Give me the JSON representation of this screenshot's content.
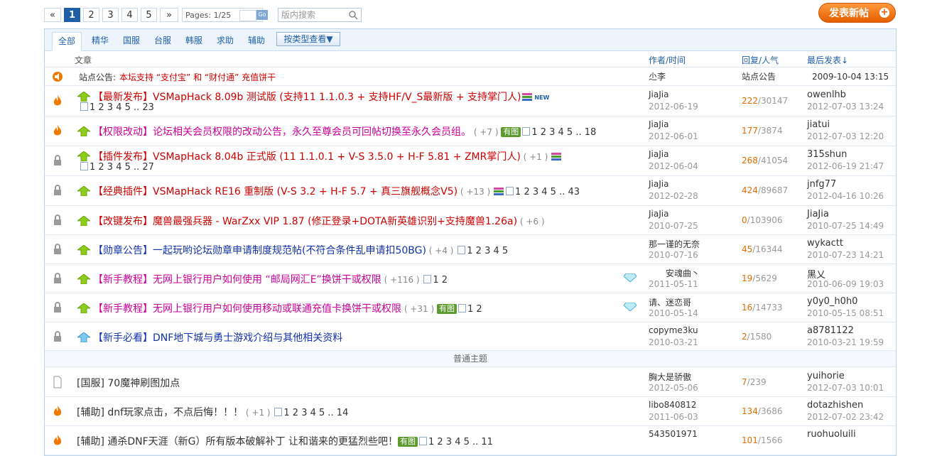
{
  "pagination": {
    "prev": "«",
    "pages": [
      "1",
      "2",
      "3",
      "4",
      "5"
    ],
    "next": "»",
    "label": "Pages: 1/25",
    "go": "Go",
    "search_placeholder": "版内搜索"
  },
  "post_button": "发表新帖",
  "tabs": [
    "全部",
    "精华",
    "国服",
    "台服",
    "韩服",
    "求助",
    "辅助"
  ],
  "type_button": "按类型查看▼",
  "header": {
    "article": "文章",
    "author": "作者/时间",
    "stats": "回复/人气",
    "last": "最后发表↓"
  },
  "announce": {
    "label": "站点公告:",
    "text": "本坛支持 “支付宝” 和 “财付通” 充值饼干",
    "author": "尐李",
    "stats": "站点公告",
    "date": "2009-10-04 13:15"
  },
  "threads": [
    {
      "cat": "【最新发布】",
      "title": "VSMapHack 8.09b 测试版 (支持11 1.1.0.3 + 支持HF/V_S最新版 + 支持掌门人)",
      "extra": "",
      "new": "NEW",
      "pages": "1 2 3 4 5 .. 23",
      "author": "JiaJia",
      "adate": "2012-06-19",
      "replies": "222",
      "views": "30147",
      "last": "owenlhb",
      "ldate": "2012-07-03 13:24"
    },
    {
      "cat": "【权限改动】",
      "title": "论坛相关会员权限的改动公告，永久至尊会员可回帖切换至永久会员组。",
      "extra": "( +7 )",
      "img": "有图",
      "pages": "1 2 3 4 5 .. 18",
      "author": "JiaJia",
      "adate": "2012-06-01",
      "replies": "177",
      "views": "3874",
      "last": "jiatui",
      "ldate": "2012-07-03 12:20"
    },
    {
      "cat": "【插件发布】",
      "title": "VSMapHack 8.04b 正式版 (11 1.1.0.1 + V-S 3.5.0 + H-F 5.81 + ZMR掌门人)",
      "extra": "( +1 )",
      "pages": "1 2 3 4 5 .. 27",
      "author": "JiaJia",
      "adate": "2012-06-04",
      "replies": "268",
      "views": "41054",
      "last": "315shun",
      "ldate": "2012-06-19 21:47"
    },
    {
      "cat": "【经典插件】",
      "title": "VSMapHack RE16 重制版 (V-S 3.2 + H-F 5.7 + 真三旗舰概念V5)",
      "extra": "( +13 )",
      "pages": "1 2 3 4 5 .. 43",
      "author": "JiaJia",
      "adate": "2012-02-28",
      "replies": "424",
      "views": "89687",
      "last": "jnfg77",
      "ldate": "2012-04-16 10:26"
    },
    {
      "cat": "【改键发布】",
      "title": "魔兽最强兵器 - WarZxx VIP 1.87 (修正登录+DOTA新英雄识别+支持魔兽1.26a)",
      "extra": "( +6 )",
      "pages": "",
      "author": "JiaJia",
      "adate": "2010-07-25",
      "replies": "0",
      "views": "103906",
      "last": "JiaJia",
      "ldate": "2010-07-25 14:49"
    },
    {
      "cat": "【勋章公告】",
      "title": "一起玩哟论坛勋章申请制度规范帖(不符合条件乱申请扣50BG)",
      "extra": "( +4 )",
      "pages": "1 2 3 4 5",
      "author": "那一谨的无奈",
      "adate": "2010-07-16",
      "replies": "45",
      "views": "16344",
      "last": "wykactt",
      "ldate": "2010-07-23 14:21"
    },
    {
      "cat": "【新手教程】",
      "title": "无网上银行用户如何使用 “邮局网汇E”换饼干或权限",
      "extra": "( +116 )",
      "pages": "1 2",
      "author": "安魂曲丶",
      "adate": "2011-05-11",
      "replies": "19",
      "views": "5629",
      "last": "黑乂",
      "ldate": "2010-06-09 19:03"
    },
    {
      "cat": "【新手教程】",
      "title": "无网上银行用户如何使用移动或联通充值卡换饼干或权限",
      "extra": "( +31 )",
      "img": "有图",
      "pages": "1 2",
      "author": "请、迷恋哥",
      "adate": "2010-05-14",
      "replies": "16",
      "views": "14733",
      "last": "y0y0_h0h0",
      "ldate": "2010-05-15 08:51"
    },
    {
      "cat": "【新手必看】",
      "title": "DNF地下城与勇士游戏介绍与其他相关资料",
      "extra": "",
      "pages": "",
      "author": "copyme3ku",
      "adate": "2010-03-21",
      "replies": "2",
      "views": "1580",
      "last": "a8781122",
      "ldate": "2010-03-21 19:59"
    }
  ],
  "separator": "普通主题",
  "normal": [
    {
      "cat": "[国服]",
      "title": "70魔神刷图加点",
      "extra": "",
      "pages": "",
      "author": "胸大是骄傲",
      "adate": "2012-05-06",
      "replies": "7",
      "views": "239",
      "last": "yuihorie",
      "ldate": "2012-07-03 10:01"
    },
    {
      "cat": "[辅助]",
      "title": "dnf玩家点击，不点后悔！！！",
      "extra": "( +1 )",
      "pages": "1 2 3 4 5 .. 14",
      "author": "libo840812",
      "adate": "2011-06-03",
      "replies": "134",
      "views": "3686",
      "last": "dotazhishen",
      "ldate": "2012-07-02 23:42"
    },
    {
      "cat": "[辅助]",
      "title": "通杀DNF天涯（新G）所有版本破解补丁 让和谐来的更猛烈些吧！",
      "extra": "",
      "img": "有图",
      "pages": "1 2 3 4 5 .. 11",
      "author": "543501971",
      "adate": "",
      "replies": "101",
      "views": "1566",
      "last": "ruohuoluili",
      "ldate": ""
    }
  ],
  "colors": {
    "brand": "#1f5fa6",
    "hot": "#cc0000",
    "pink": "#cc0099",
    "reply": "#e06c00"
  }
}
